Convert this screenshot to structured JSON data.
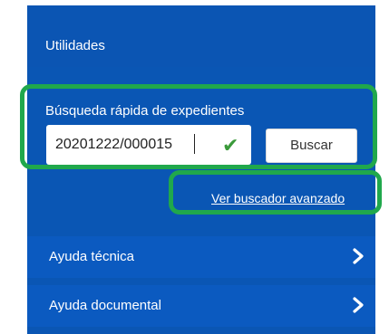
{
  "panel": {
    "title": "Utilidades"
  },
  "quick_search": {
    "label": "Búsqueda rápida de expedientes",
    "input_value": "20201222/000015",
    "validation_icon": "check-icon",
    "button_label": "Buscar"
  },
  "advanced_link": "Ver buscador avanzado",
  "nav": [
    {
      "label": "Ayuda técnica",
      "icon": "chevron-right-icon"
    },
    {
      "label": "Ayuda documental",
      "icon": "chevron-right-icon"
    }
  ],
  "colors": {
    "panel_bg": "#0a56b4",
    "nav_bg": "#0b5ac0",
    "highlight": "#20a84c",
    "check": "#3a9a3a"
  }
}
